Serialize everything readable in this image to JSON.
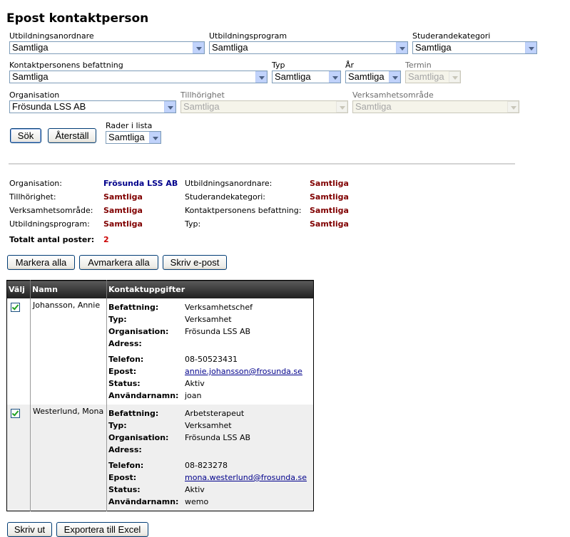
{
  "page_title": "Epost kontaktperson",
  "filters": {
    "utbildningsanordnare": {
      "label": "Utbildningsanordnare",
      "value": "Samtliga"
    },
    "utbildningsprogram": {
      "label": "Utbildningsprogram",
      "value": "Samtliga"
    },
    "studerandekategori": {
      "label": "Studerandekategori",
      "value": "Samtliga"
    },
    "befattning": {
      "label": "Kontaktpersonens befattning",
      "value": "Samtliga"
    },
    "typ": {
      "label": "Typ",
      "value": "Samtliga"
    },
    "ar": {
      "label": "År",
      "value": "Samtliga"
    },
    "termin": {
      "label": "Termin",
      "value": "Samtliga"
    },
    "organisation": {
      "label": "Organisation",
      "value": "Frösunda LSS AB"
    },
    "tillhorighet": {
      "label": "Tillhörighet",
      "value": "Samtliga"
    },
    "verksamhetsomrade": {
      "label": "Verksamhetsområde",
      "value": "Samtliga"
    },
    "rader": {
      "label": "Rader i lista",
      "value": "Samtliga"
    }
  },
  "buttons": {
    "sok": "Sök",
    "aterstall": "Återställ",
    "markera_alla": "Markera alla",
    "avmarkera_alla": "Avmarkera alla",
    "skriv_epost": "Skriv e-post",
    "skriv_ut": "Skriv ut",
    "exportera": "Exportera till Excel"
  },
  "summary": {
    "organisation": {
      "label": "Organisation:",
      "value": "Frösunda LSS AB"
    },
    "tillhorighet": {
      "label": "Tillhörighet:",
      "value": "Samtliga"
    },
    "verksamhetsomrade": {
      "label": "Verksamhetsområde:",
      "value": "Samtliga"
    },
    "utbildningsprogram": {
      "label": "Utbildningsprogram:",
      "value": "Samtliga"
    },
    "utbildningsanordnare": {
      "label": "Utbildningsanordnare:",
      "value": "Samtliga"
    },
    "studerandekategori": {
      "label": "Studerandekategori:",
      "value": "Samtliga"
    },
    "befattning": {
      "label": "Kontaktpersonens befattning:",
      "value": "Samtliga"
    },
    "typ": {
      "label": "Typ:",
      "value": "Samtliga"
    },
    "totalt": {
      "label": "Totalt antal poster:",
      "value": "2"
    }
  },
  "table": {
    "headers": {
      "valj": "Välj",
      "namn": "Namn",
      "kontakt": "Kontaktuppgifter"
    },
    "field_labels": {
      "befattning": "Befattning:",
      "typ": "Typ:",
      "organisation": "Organisation:",
      "adress": "Adress:",
      "telefon": "Telefon:",
      "epost": "Epost:",
      "status": "Status:",
      "anvandarnamn": "Användarnamn:"
    },
    "rows": [
      {
        "checked": true,
        "namn": "Johansson, Annie",
        "befattning": "Verksamhetschef",
        "typ": "Verksamhet",
        "organisation": "Frösunda LSS AB",
        "adress": "",
        "telefon": "08-50523431",
        "epost": "annie.johansson@frosunda.se",
        "status": "Aktiv",
        "anvandarnamn": "joan"
      },
      {
        "checked": true,
        "namn": "Westerlund, Mona",
        "befattning": "Arbetsterapeut",
        "typ": "Verksamhet",
        "organisation": "Frösunda LSS AB",
        "adress": "",
        "telefon": "08-823278",
        "epost": "mona.westerlund@frosunda.se",
        "status": "Aktiv",
        "anvandarnamn": "wemo"
      }
    ]
  }
}
